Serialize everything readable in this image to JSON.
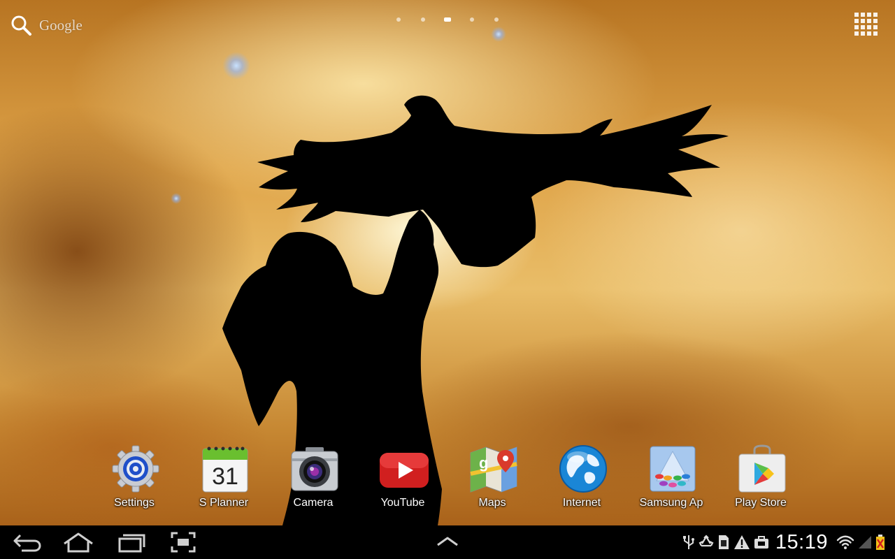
{
  "search": {
    "label": "Google"
  },
  "pages": {
    "count": 5,
    "active": 3
  },
  "dock": {
    "apps": [
      {
        "label": "Settings",
        "icon": "settings-gear-icon"
      },
      {
        "label": "S Planner",
        "icon": "calendar-icon",
        "icon_text": "31"
      },
      {
        "label": "Camera",
        "icon": "camera-icon"
      },
      {
        "label": "YouTube",
        "icon": "youtube-icon"
      },
      {
        "label": "Maps",
        "icon": "maps-icon"
      },
      {
        "label": "Internet",
        "icon": "globe-icon"
      },
      {
        "label": "Samsung Ap",
        "icon": "samsung-apps-icon"
      },
      {
        "label": "Play Store",
        "icon": "play-store-bag-icon"
      }
    ]
  },
  "navbar": {
    "buttons": [
      "back-icon",
      "home-icon",
      "recent-apps-icon",
      "screenshot-icon",
      "chevron-up-icon"
    ]
  },
  "status": {
    "time": "15:19",
    "icons": [
      "usb-icon",
      "recycle-icon",
      "sd-card-icon",
      "warning-icon",
      "briefcase-icon",
      "wifi-icon",
      "signal-icon",
      "battery-low-icon"
    ]
  },
  "colors": {
    "navbar": "#000000",
    "sky_light": "#f6dc9a",
    "sky_dark": "#a9621a",
    "label": "#ffffff"
  }
}
